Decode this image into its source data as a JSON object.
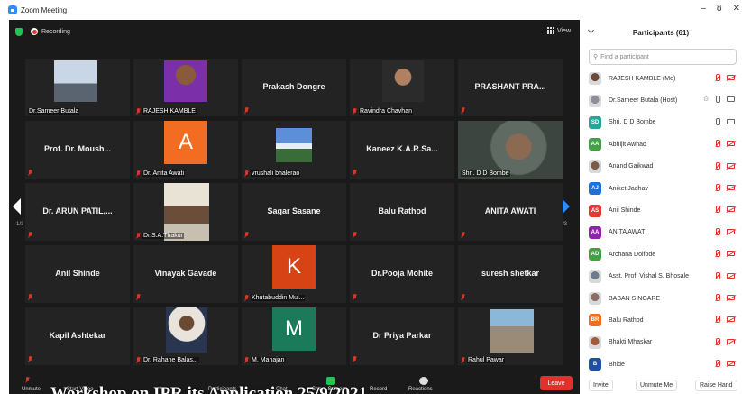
{
  "window": {
    "title": "Zoom Meeting",
    "controls": [
      "–",
      "ʊ",
      "✕"
    ]
  },
  "meeting": {
    "recording_label": "Recording",
    "view_label": "View",
    "page_left": "1/3",
    "page_right": "1/3",
    "caption": "Workshop on IPR its Application 25/9/2021"
  },
  "tiles": [
    {
      "type": "photo",
      "label": "Dr.Sameer Butala",
      "mic_muted": false
    },
    {
      "type": "photo",
      "label": "RAJESH KAMBLE",
      "mic_muted": true
    },
    {
      "type": "name",
      "name": "Prakash Dongre",
      "mic_muted": true
    },
    {
      "type": "photo",
      "label": "Ravindra Chavhan",
      "mic_muted": true
    },
    {
      "type": "name",
      "name": "PRASHANT PRA...",
      "mic_muted": true
    },
    {
      "type": "name",
      "name": "Prof. Dr. Moush...",
      "mic_muted": true
    },
    {
      "type": "avatar",
      "letter": "A",
      "color": "#f26d21",
      "label": "Dr. Anita Awati",
      "mic_muted": true
    },
    {
      "type": "photo",
      "label": "vrushali bhalerao",
      "mic_muted": true
    },
    {
      "type": "name",
      "name": "Kaneez  K.A.R.Sa...",
      "mic_muted": true
    },
    {
      "type": "photo",
      "label": "Shri. D D Bombe",
      "mic_muted": false,
      "active": true
    },
    {
      "type": "name",
      "name": "Dr. ARUN PATIL,...",
      "mic_muted": true
    },
    {
      "type": "photo",
      "label": "Dr.S.A.Thakur",
      "mic_muted": true
    },
    {
      "type": "name",
      "name": "Sagar Sasane",
      "mic_muted": true
    },
    {
      "type": "name",
      "name": "Balu Rathod",
      "mic_muted": true
    },
    {
      "type": "name",
      "name": "ANITA AWATI",
      "mic_muted": true
    },
    {
      "type": "name",
      "name": "Anil Shinde",
      "mic_muted": true
    },
    {
      "type": "name",
      "name": "Vinayak Gavade",
      "mic_muted": true
    },
    {
      "type": "avatar",
      "letter": "K",
      "color": "#d84315",
      "label": "Khutabuddin Mul...",
      "mic_muted": true
    },
    {
      "type": "name",
      "name": "Dr.Pooja Mohite",
      "mic_muted": true
    },
    {
      "type": "name",
      "name": "suresh shetkar",
      "mic_muted": true
    },
    {
      "type": "name",
      "name": "Kapil Ashtekar",
      "mic_muted": true
    },
    {
      "type": "photo",
      "label": "Dr. Rahane Balas...",
      "mic_muted": true
    },
    {
      "type": "avatar",
      "letter": "M",
      "color": "#1b7a5a",
      "label": "M. Mahajan",
      "mic_muted": true
    },
    {
      "type": "name",
      "name": "Dr Priya Parkar",
      "mic_muted": true
    },
    {
      "type": "photo",
      "label": "Rahul Pawar",
      "mic_muted": true
    }
  ],
  "toolbar": {
    "items": [
      "Unmute",
      "Start Video",
      "Participants",
      "Chat",
      "Share Screen",
      "Record",
      "Reactions"
    ],
    "leave_label": "Leave"
  },
  "participants": {
    "title": "Participants (61)",
    "search_placeholder": "Find a participant",
    "list": [
      {
        "name": "RAJESH KAMBLE (Me)",
        "initials": "",
        "color": "#6b4a3a",
        "photo": true,
        "mic": "muted",
        "cam": "off"
      },
      {
        "name": "Dr.Sameer Butala (Host)",
        "initials": "",
        "color": "#8a8f99",
        "photo": true,
        "mic": "on",
        "cam": "on",
        "extra": "⊙"
      },
      {
        "name": "Shri. D D Bombe",
        "initials": "SD",
        "color": "#26a69a",
        "photo": false,
        "mic": "on",
        "cam": "on"
      },
      {
        "name": "Abhijit Awhad",
        "initials": "AA",
        "color": "#43a047",
        "photo": false,
        "mic": "muted",
        "cam": "off"
      },
      {
        "name": "Anand Gaikwad",
        "initials": "",
        "color": "#7a5c48",
        "photo": true,
        "mic": "muted",
        "cam": "off"
      },
      {
        "name": "Aniket Jadhav",
        "initials": "AJ",
        "color": "#1e6fd9",
        "photo": false,
        "mic": "muted",
        "cam": "off"
      },
      {
        "name": "Anil Shinde",
        "initials": "AS",
        "color": "#e53935",
        "photo": false,
        "mic": "muted",
        "cam": "off"
      },
      {
        "name": "ANITA AWATI",
        "initials": "AA",
        "color": "#8e24aa",
        "photo": false,
        "mic": "muted",
        "cam": "off"
      },
      {
        "name": "Archana Doifode",
        "initials": "AD",
        "color": "#43a047",
        "photo": false,
        "mic": "muted",
        "cam": "off"
      },
      {
        "name": "Asst. Prof. Vishal S. Bhosale",
        "initials": "",
        "color": "#6d7c8a",
        "photo": true,
        "mic": "muted",
        "cam": "off"
      },
      {
        "name": "BABAN SINGARE",
        "initials": "",
        "color": "#8d6e63",
        "photo": true,
        "mic": "muted",
        "cam": "off"
      },
      {
        "name": "Balu Rathod",
        "initials": "BR",
        "color": "#f26d21",
        "photo": false,
        "mic": "muted",
        "cam": "off"
      },
      {
        "name": "Bhakti Mhaskar",
        "initials": "",
        "color": "#a05a3c",
        "photo": true,
        "mic": "muted",
        "cam": "off"
      },
      {
        "name": "Bhide",
        "initials": "B",
        "color": "#1e4fa0",
        "photo": false,
        "mic": "muted",
        "cam": "off"
      }
    ],
    "footer": {
      "invite": "Invite",
      "unmute_me": "Unmute Me",
      "raise_hand": "Raise Hand"
    }
  }
}
